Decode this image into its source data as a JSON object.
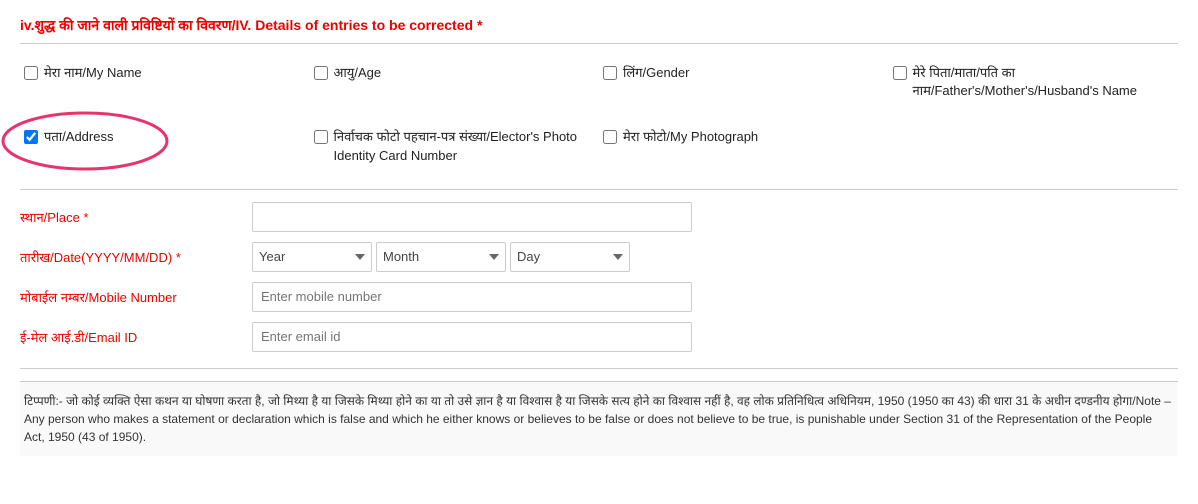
{
  "section": {
    "title": "iv.शुद्ध की जाने वाली प्रविष्टियों का विवरण/IV. Details of entries to be corrected",
    "required_marker": "*"
  },
  "checkboxes": [
    {
      "id": "my-name",
      "label": "मेरा नाम/My Name",
      "checked": false
    },
    {
      "id": "age",
      "label": "आयु/Age",
      "checked": false
    },
    {
      "id": "gender",
      "label": "लिंग/Gender",
      "checked": false
    },
    {
      "id": "father-name",
      "label": "मेरे पिता/माता/पति का नाम/Father's/Mother's/Husband's Name",
      "checked": false
    },
    {
      "id": "address",
      "label": "पता/Address",
      "checked": true
    },
    {
      "id": "elector-card",
      "label": "निर्वाचक फोटो पहचान-पत्र संख्या/Elector's Photo Identity Card Number",
      "checked": false
    },
    {
      "id": "my-photo",
      "label": "मेरा फोटो/My Photograph",
      "checked": false
    }
  ],
  "form": {
    "place_label": "स्थान/Place",
    "place_required": "*",
    "place_placeholder": "",
    "date_label": "तारीख/Date(YYYY/MM/DD)",
    "date_required": "*",
    "year_placeholder": "Year",
    "month_placeholder": "Month",
    "day_placeholder": "Day",
    "mobile_label": "मोबाईल नम्बर/Mobile Number",
    "mobile_placeholder": "Enter mobile number",
    "email_label": "ई-मेल आई.डी/Email ID",
    "email_placeholder": "Enter email id"
  },
  "note": {
    "text": "टिप्पणी:- जो कोई व्यक्ति ऐसा कथन या घोषणा करता है, जो मिथ्या है या जिसके मिथ्या होने का या तो उसे ज्ञान है या विश्वास है या जिसके सत्य होने का विश्वास नहीं है, वह लोक प्रतिनिधित्व अधिनियम, 1950 (1950 का 43) की धारा 31 के अधीन दण्डनीय होगा/Note – Any person who makes a statement or declaration which is false and which he either knows or believes to be false or does not believe to be true, is punishable under Section 31 of the Representation of the People Act, 1950 (43 of 1950)."
  }
}
